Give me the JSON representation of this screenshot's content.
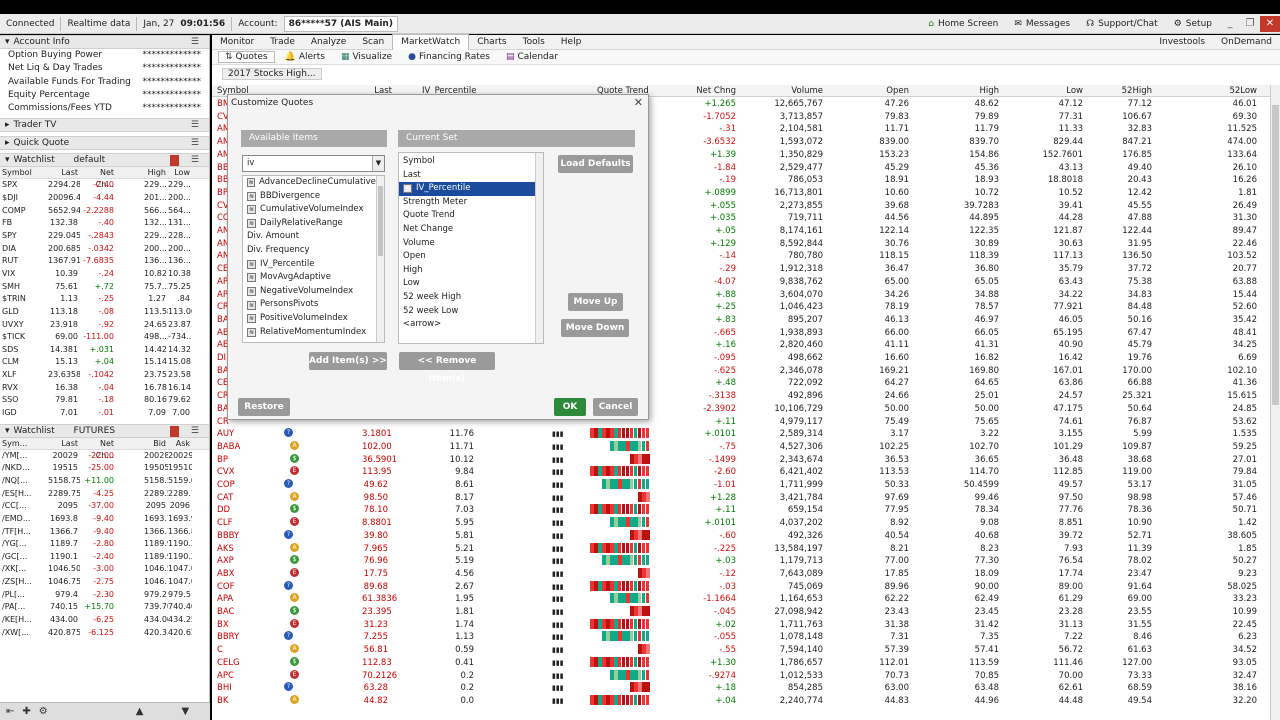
{
  "status": {
    "connected": "Connected",
    "realtime": "Realtime data",
    "date": "Jan, 27",
    "time": "09:01:56",
    "account_label": "Account:",
    "account": "86*****57 (AIS Main)",
    "home": "Home Screen",
    "messages": "Messages",
    "support": "Support/Chat",
    "setup": "Setup"
  },
  "account_info": {
    "title": "Account Info",
    "rows": [
      {
        "label": "Option Buying Power",
        "value": "*************"
      },
      {
        "label": "Net Liq & Day Trades",
        "value": "*************"
      },
      {
        "label": "Available Funds For Trading",
        "value": "*************"
      },
      {
        "label": "Equity Percentage",
        "value": "*************"
      },
      {
        "label": "Commissions/Fees YTD",
        "value": "*************"
      }
    ]
  },
  "trader_tv": "Trader TV",
  "quick_quote": "Quick Quote",
  "watchlist1": {
    "title": "Watchlist",
    "name": "default",
    "headers": [
      "Symbol",
      "Last",
      "Net Ch...",
      "",
      "High",
      "Low"
    ],
    "rows": [
      [
        "SPX",
        "2294.28",
        "-2.40",
        "",
        "229...",
        "229..."
      ],
      [
        "$DJI",
        "20096.47",
        "-4.44",
        "",
        "201...",
        "200..."
      ],
      [
        "COMP",
        "5652.947",
        "-2.2288",
        "",
        "566...",
        "564..."
      ],
      [
        "FB",
        "132.38",
        "-.40",
        "",
        "132...",
        "131..."
      ],
      [
        "SPY",
        "229.0457",
        "-.2843",
        "",
        "229...",
        "228..."
      ],
      [
        "DIA",
        "200.6858",
        "-.0342",
        "",
        "200...",
        "200..."
      ],
      [
        "RUT",
        "1367.9116",
        "-7.6835",
        "",
        "136...",
        "136..."
      ],
      [
        "VIX",
        "10.39",
        "-.24",
        "",
        "10.82",
        "10.38"
      ],
      [
        "SMH",
        "75.61",
        "+.72",
        "",
        "75.7...",
        "75.25"
      ],
      [
        "$TRIN",
        "1.13",
        "-.25",
        "",
        "1.27",
        ".84"
      ],
      [
        "GLD",
        "113.18",
        "-.08",
        "",
        "113.58",
        "113.06"
      ],
      [
        "UVXY",
        "23.918",
        "-.92",
        "",
        "24.65",
        "23.87"
      ],
      [
        "$TICK",
        "69.00",
        "-111.00",
        "",
        "498....",
        "-734..."
      ],
      [
        "SDS",
        "14.381",
        "+.031",
        "",
        "14.42",
        "14.32"
      ],
      [
        "CLM",
        "15.13",
        "+.04",
        "",
        "15.14",
        "15.08"
      ],
      [
        "XLF",
        "23.6358",
        "-.1042",
        "",
        "23.75",
        "23.58"
      ],
      [
        "RVX",
        "16.38",
        "-.04",
        "",
        "16.78",
        "16.14"
      ],
      [
        "SSO",
        "79.81",
        "-.18",
        "",
        "80.16",
        "79.62"
      ],
      [
        "IGD",
        "7.01",
        "-.01",
        "",
        "7.09",
        "7.00"
      ]
    ]
  },
  "watchlist2": {
    "title": "Watchlist",
    "name": "FUTURES",
    "headers": [
      "Sym...",
      "Last",
      "Net Ch...",
      "",
      "Bid",
      "Ask"
    ],
    "rows": [
      [
        "/YM[...",
        "20029",
        "-22.00",
        "",
        "20028",
        "20029"
      ],
      [
        "/NKD...",
        "19515",
        "-25.00",
        "",
        "19505",
        "19510"
      ],
      [
        "/NQ[...",
        "5158.75",
        "+11.00",
        "",
        "5158.50",
        "5159.00"
      ],
      [
        "/ES[H...",
        "2289.75",
        "-4.25",
        "",
        "2289.50",
        "2289.75"
      ],
      [
        "/CC[...",
        "2095",
        "-37.00",
        "",
        "2095",
        "2096"
      ],
      [
        "/EMD...",
        "1693.8",
        "-9.40",
        "",
        "1693.7",
        "1693.9"
      ],
      [
        "/TF[H...",
        "1366.7",
        "-9.40",
        "",
        "1366.7",
        "1366.8"
      ],
      [
        "/YG[...",
        "1189.7",
        "-2.80",
        "",
        "1189.9",
        "1190.2"
      ],
      [
        "/GC[...",
        "1190.1",
        "-2.40",
        "",
        "1189.9",
        "1190.2"
      ],
      [
        "/XK[...",
        "1046.500",
        "-3.00",
        "",
        "1046.5...",
        "1047.0..."
      ],
      [
        "/ZS[H...",
        "1046.75",
        "-2.75",
        "",
        "1046.75",
        "1047.00"
      ],
      [
        "/PL[...",
        "979.4",
        "-2.30",
        "",
        "979.2",
        "979.5"
      ],
      [
        "/PA[...",
        "740.15",
        "+15.70",
        "",
        "739.70",
        "740.40"
      ],
      [
        "/KE[H...",
        "434.00",
        "-6.25",
        "",
        "434.00",
        "434.25"
      ],
      [
        "/XW[...",
        "420.875",
        "-6.125",
        "",
        "420.3...",
        "420.625"
      ]
    ]
  },
  "nav": {
    "tabs": [
      "Monitor",
      "Trade",
      "Analyze",
      "Scan",
      "MarketWatch",
      "Charts",
      "Tools",
      "Help"
    ],
    "right": [
      "Investools",
      "OnDemand"
    ],
    "subtabs": [
      "Quotes",
      "Alerts",
      "Visualize",
      "Financing Rates",
      "Calendar"
    ],
    "list_name": "2017 Stocks High..."
  },
  "grid": {
    "headers": {
      "symbol": "Symbol",
      "last": "Last",
      "ivp": "IV_Percentile",
      "qt": "Quote Trend",
      "netchg": "Net Chng",
      "volume": "Volume",
      "open": "Open",
      "high": "High",
      "low": "Low",
      "w52h": "52High",
      "w52l": "52Low"
    },
    "rows_partial": [
      [
        "BM",
        "+1.265",
        "12,665,767",
        "47.26",
        "48.62",
        "47.12",
        "77.12",
        "46.01"
      ],
      [
        "CV",
        "-1.7052",
        "3,713,857",
        "79.83",
        "79.89",
        "77.31",
        "106.67",
        "69.30"
      ],
      [
        "AM",
        "-.31",
        "2,104,581",
        "11.71",
        "11.79",
        "11.33",
        "32.83",
        "11.525"
      ],
      [
        "AM",
        "-3.6532",
        "1,593,072",
        "839.00",
        "839.70",
        "829.44",
        "847.21",
        "474.00"
      ],
      [
        "AM",
        "+1.39",
        "1,350,829",
        "153.23",
        "154.86",
        "152.7601",
        "176.85",
        "133.64"
      ],
      [
        "BB",
        "-1.84",
        "2,529,477",
        "45.29",
        "45.36",
        "43.13",
        "49.40",
        "26.10"
      ],
      [
        "BB",
        "-.19",
        "786,053",
        "18.91",
        "18.93",
        "18.8018",
        "20.43",
        "16.26"
      ],
      [
        "BP",
        "+.0899",
        "16,713,801",
        "10.60",
        "10.72",
        "10.52",
        "12.42",
        "1.81"
      ],
      [
        "CV",
        "+.055",
        "2,273,855",
        "39.68",
        "39.7283",
        "39.41",
        "45.55",
        "26.49"
      ],
      [
        "CO",
        "+.035",
        "719,711",
        "44.56",
        "44.895",
        "44.28",
        "47.88",
        "31.30"
      ],
      [
        "AN",
        "+.05",
        "8,174,161",
        "122.14",
        "122.35",
        "121.87",
        "122.44",
        "89.47"
      ],
      [
        "AN",
        "+.129",
        "8,592,844",
        "30.76",
        "30.89",
        "30.63",
        "31.95",
        "22.46"
      ],
      [
        "AN",
        "-.14",
        "780,780",
        "118.15",
        "118.39",
        "117.13",
        "136.50",
        "103.52"
      ],
      [
        "CE",
        "-.29",
        "1,912,318",
        "36.47",
        "36.80",
        "35.79",
        "37.72",
        "20.77"
      ],
      [
        "AP",
        "-4.07",
        "9,838,762",
        "65.00",
        "65.05",
        "63.43",
        "75.38",
        "63.88"
      ],
      [
        "AP",
        "+.88",
        "3,604,070",
        "34.26",
        "34.88",
        "34.22",
        "34.83",
        "15.44"
      ],
      [
        "CR",
        "+.25",
        "1,046,423",
        "78.19",
        "78.57",
        "77.921",
        "84.48",
        "52.60"
      ],
      [
        "BA",
        "+.83",
        "895,207",
        "46.13",
        "46.97",
        "46.05",
        "50.16",
        "35.42"
      ],
      [
        "AB",
        "-.665",
        "1,938,893",
        "66.00",
        "66.05",
        "65.195",
        "67.47",
        "48.41"
      ],
      [
        "AE",
        "+.16",
        "2,820,460",
        "41.11",
        "41.31",
        "40.90",
        "45.79",
        "34.25"
      ],
      [
        "DI",
        "-.095",
        "498,662",
        "16.60",
        "16.82",
        "16.42",
        "19.76",
        "6.69"
      ],
      [
        "BA",
        "-.625",
        "2,346,078",
        "169.21",
        "169.80",
        "167.01",
        "170.00",
        "102.10"
      ],
      [
        "CE",
        "+.48",
        "722,092",
        "64.27",
        "64.65",
        "63.86",
        "66.88",
        "41.36"
      ],
      [
        "CR",
        "-.3138",
        "492,896",
        "24.66",
        "25.01",
        "24.57",
        "25.321",
        "15.615"
      ],
      [
        "BA",
        "-2.3902",
        "10,106,729",
        "50.00",
        "50.00",
        "47.175",
        "50.64",
        "24.85"
      ],
      [
        "CR",
        "+.11",
        "4,979,117",
        "75.49",
        "75.65",
        "74.61",
        "76.87",
        "53.62"
      ]
    ],
    "rows_full": [
      {
        "sym": "AUY",
        "last": "3.1801",
        "ivp": "11.76",
        "netchg": "+.0101",
        "volume": "2,589,314",
        "open": "3.17",
        "high": "3.22",
        "low": "3.155",
        "w52h": "5.99",
        "w52l": "1.535"
      },
      {
        "sym": "BABA",
        "last": "102.00",
        "ivp": "11.71",
        "netchg": "-.75",
        "volume": "4,527,306",
        "open": "102.25",
        "high": "102.70",
        "low": "101.29",
        "w52h": "109.87",
        "w52l": "59.25"
      },
      {
        "sym": "BP",
        "last": "36.5901",
        "ivp": "10.12",
        "netchg": "-.1499",
        "volume": "2,343,674",
        "open": "36.53",
        "high": "36.65",
        "low": "36.48",
        "w52h": "38.68",
        "w52l": "27.01"
      },
      {
        "sym": "CVX",
        "last": "113.95",
        "ivp": "9.84",
        "netchg": "-2.60",
        "volume": "6,421,402",
        "open": "113.53",
        "high": "114.70",
        "low": "112.85",
        "w52h": "119.00",
        "w52l": "79.84"
      },
      {
        "sym": "COP",
        "last": "49.62",
        "ivp": "8.61",
        "netchg": "-1.01",
        "volume": "1,711,999",
        "open": "50.33",
        "high": "50.4599",
        "low": "49.57",
        "w52h": "53.17",
        "w52l": "31.05"
      },
      {
        "sym": "CAT",
        "last": "98.50",
        "ivp": "8.17",
        "netchg": "+1.28",
        "volume": "3,421,784",
        "open": "97.69",
        "high": "99.46",
        "low": "97.50",
        "w52h": "98.98",
        "w52l": "57.46"
      },
      {
        "sym": "DD",
        "last": "78.10",
        "ivp": "7.03",
        "netchg": "+.11",
        "volume": "659,154",
        "open": "77.95",
        "high": "78.34",
        "low": "77.76",
        "w52h": "78.36",
        "w52l": "50.71"
      },
      {
        "sym": "CLF",
        "last": "8.8801",
        "ivp": "5.95",
        "netchg": "+.0101",
        "volume": "4,037,202",
        "open": "8.92",
        "high": "9.08",
        "low": "8.851",
        "w52h": "10.90",
        "w52l": "1.42"
      },
      {
        "sym": "BBBY",
        "last": "39.80",
        "ivp": "5.81",
        "netchg": "-.60",
        "volume": "492,326",
        "open": "40.54",
        "high": "40.68",
        "low": "39.72",
        "w52h": "52.71",
        "w52l": "38.605"
      },
      {
        "sym": "AKS",
        "last": "7.965",
        "ivp": "5.21",
        "netchg": "-.225",
        "volume": "13,584,197",
        "open": "8.21",
        "high": "8.23",
        "low": "7.93",
        "w52h": "11.39",
        "w52l": "1.85"
      },
      {
        "sym": "AXP",
        "last": "76.96",
        "ivp": "5.19",
        "netchg": "+.03",
        "volume": "1,179,713",
        "open": "77.00",
        "high": "77.30",
        "low": "76.54",
        "w52h": "78.02",
        "w52l": "50.27"
      },
      {
        "sym": "ABX",
        "last": "17.75",
        "ivp": "4.56",
        "netchg": "-.12",
        "volume": "7,643,089",
        "open": "17.85",
        "high": "18.09",
        "low": "17.74",
        "w52h": "23.47",
        "w52l": "9.23"
      },
      {
        "sym": "COF",
        "last": "89.68",
        "ivp": "2.67",
        "netchg": "-.03",
        "volume": "745,069",
        "open": "89.96",
        "high": "90.00",
        "low": "89.00",
        "w52h": "91.64",
        "w52l": "58.025"
      },
      {
        "sym": "APA",
        "last": "61.3836",
        "ivp": "1.95",
        "netchg": "-1.1664",
        "volume": "1,164,653",
        "open": "62.22",
        "high": "62.49",
        "low": "61.29",
        "w52h": "69.00",
        "w52l": "33.23"
      },
      {
        "sym": "BAC",
        "last": "23.395",
        "ivp": "1.81",
        "netchg": "-.045",
        "volume": "27,098,942",
        "open": "23.43",
        "high": "23.45",
        "low": "23.28",
        "w52h": "23.55",
        "w52l": "10.99"
      },
      {
        "sym": "BX",
        "last": "31.23",
        "ivp": "1.74",
        "netchg": "+.02",
        "volume": "1,711,763",
        "open": "31.38",
        "high": "31.42",
        "low": "31.13",
        "w52h": "31.55",
        "w52l": "22.45"
      },
      {
        "sym": "BBRY",
        "last": "7.255",
        "ivp": "1.13",
        "netchg": "-.055",
        "volume": "1,078,148",
        "open": "7.31",
        "high": "7.35",
        "low": "7.22",
        "w52h": "8.46",
        "w52l": "6.23"
      },
      {
        "sym": "C",
        "last": "56.81",
        "ivp": "0.59",
        "netchg": "-.55",
        "volume": "7,594,140",
        "open": "57.39",
        "high": "57.41",
        "low": "56.72",
        "w52h": "61.63",
        "w52l": "34.52"
      },
      {
        "sym": "CELG",
        "last": "112.83",
        "ivp": "0.41",
        "netchg": "+1.30",
        "volume": "1,786,657",
        "open": "112.01",
        "high": "113.59",
        "low": "111.46",
        "w52h": "127.00",
        "w52l": "93.05"
      },
      {
        "sym": "APC",
        "last": "70.2126",
        "ivp": "0.2",
        "netchg": "-.9274",
        "volume": "1,012,533",
        "open": "70.73",
        "high": "70.85",
        "low": "70.00",
        "w52h": "73.33",
        "w52l": "32.47"
      },
      {
        "sym": "BHI",
        "last": "63.28",
        "ivp": "0.2",
        "netchg": "+.18",
        "volume": "854,285",
        "open": "63.00",
        "high": "63.48",
        "low": "62.61",
        "w52h": "68.59",
        "w52l": "38.16"
      },
      {
        "sym": "BK",
        "last": "44.82",
        "ivp": "0.0",
        "netchg": "+.04",
        "volume": "2,240,774",
        "open": "44.83",
        "high": "44.96",
        "low": "44.48",
        "w52h": "49.54",
        "w52l": "32.20"
      }
    ]
  },
  "dialog": {
    "title": "Customize Quotes",
    "available_label": "Available Items",
    "current_label": "Current Set",
    "filter_value": "iv",
    "available": [
      {
        "label": "AdvanceDeclineCumulative...",
        "study": true
      },
      {
        "label": "BBDivergence",
        "study": true
      },
      {
        "label": "CumulativeVolumeIndex",
        "study": true
      },
      {
        "label": "DailyRelativeRange",
        "study": true
      },
      {
        "label": "Div. Amount",
        "study": false
      },
      {
        "label": "Div. Frequency",
        "study": false
      },
      {
        "label": "IV_Percentile",
        "study": true
      },
      {
        "label": "MovAvgAdaptive",
        "study": true
      },
      {
        "label": "NegativeVolumeIndex",
        "study": true
      },
      {
        "label": "PersonsPivots",
        "study": true
      },
      {
        "label": "PositiveVolumeIndex",
        "study": true
      },
      {
        "label": "RelativeMomentumIndex",
        "study": true
      }
    ],
    "current": [
      {
        "label": "Symbol",
        "study": false
      },
      {
        "label": "Last",
        "study": false
      },
      {
        "label": "IV_Percentile",
        "study": true
      },
      {
        "label": "Strength Meter",
        "study": false
      },
      {
        "label": "Quote Trend",
        "study": false
      },
      {
        "label": "Net Change",
        "study": false
      },
      {
        "label": "Volume",
        "study": false
      },
      {
        "label": "Open",
        "study": false
      },
      {
        "label": "High",
        "study": false
      },
      {
        "label": "Low",
        "study": false
      },
      {
        "label": "52 week High",
        "study": false
      },
      {
        "label": "52 week Low",
        "study": false
      },
      {
        "label": "<arrow>",
        "study": false
      }
    ],
    "buttons": {
      "load_defaults": "Load Defaults",
      "move_up": "Move Up",
      "move_down": "Move Down",
      "add": "Add Item(s) >>",
      "remove": "<< Remove Item(s)",
      "restore": "Restore",
      "ok": "OK",
      "cancel": "Cancel"
    }
  }
}
